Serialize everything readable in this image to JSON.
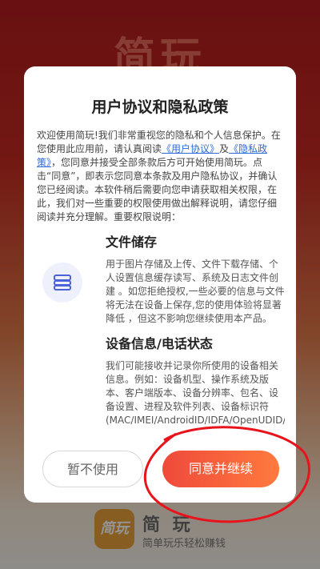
{
  "background": {
    "splash_title": "简玩",
    "logo_text": "简玩",
    "app_name": "简 玩",
    "slogan": "简单玩乐轻松赚钱"
  },
  "dialog": {
    "title": "用户协议和隐私政策",
    "intro": {
      "part1": "欢迎使用简玩!我们非常重视您的隐私和个人信息保护。在您使用此应用前，请认真阅读",
      "link_terms": "《用户协议》",
      "and": "及",
      "link_privacy": "《隐私政策》",
      "part2": "，您同意并接受全部条款后方可开始使用简玩。点击“同意”，即表示您同意本条款及用户隐私协议，并确认您已经阅读。本软件稍后需要向您申请获取相关权限，在此，我们对一些重要的权限使用做出解释说明，请您仔细阅读并充分理解。重要权限说明："
    },
    "sections": [
      {
        "title": "文件储存",
        "icon": "storage-icon",
        "body": "用于图片存储及上传、文件下载存储、个人设置信息缓存读写、系统及日志文件创建 。如您拒绝授权,一些必要的信息与文件将无法在设备上保存,您的使用体验将显著降低 ，但这不影响您继续使用本产品。"
      },
      {
        "title": "设备信息/电话状态",
        "body": "我们可能接收并记录你所使用的设备相关信息。例如：设备机型、操作系统及版 本、客户端版本、设备分辨率、包名、设备设置、进程及软件列表、设备标识符(MAC/IMEI/AndroidID/IDFA/OpenUDID/"
      }
    ],
    "buttons": {
      "reject": "暂不使用",
      "accept": "同意并继续"
    }
  },
  "colors": {
    "accent_start": "#ee4a3b",
    "accent_end": "#ff7a3e",
    "link": "#2f6bd6",
    "annotation": "#e8141c"
  }
}
